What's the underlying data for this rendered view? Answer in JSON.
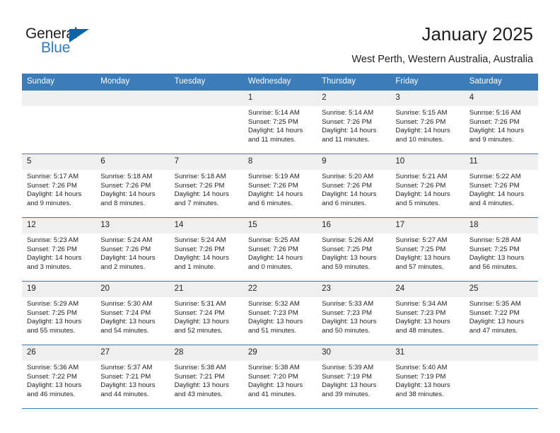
{
  "brand": {
    "name_part1": "General",
    "name_part2": "Blue",
    "triangle_color": "#1263a4",
    "blue_color": "#2b7cc4"
  },
  "header": {
    "title": "January 2025",
    "subtitle": "West Perth, Western Australia, Australia",
    "header_bg": "#3b7cb9"
  },
  "calendar": {
    "weekday_headers": [
      "Sunday",
      "Monday",
      "Tuesday",
      "Wednesday",
      "Thursday",
      "Friday",
      "Saturday"
    ],
    "weeks": [
      [
        {
          "day": "",
          "empty": true
        },
        {
          "day": "",
          "empty": true
        },
        {
          "day": "",
          "empty": true
        },
        {
          "day": "1",
          "sunrise": "Sunrise: 5:14 AM",
          "sunset": "Sunset: 7:25 PM",
          "daylight": "Daylight: 14 hours and 11 minutes."
        },
        {
          "day": "2",
          "sunrise": "Sunrise: 5:14 AM",
          "sunset": "Sunset: 7:26 PM",
          "daylight": "Daylight: 14 hours and 11 minutes."
        },
        {
          "day": "3",
          "sunrise": "Sunrise: 5:15 AM",
          "sunset": "Sunset: 7:26 PM",
          "daylight": "Daylight: 14 hours and 10 minutes."
        },
        {
          "day": "4",
          "sunrise": "Sunrise: 5:16 AM",
          "sunset": "Sunset: 7:26 PM",
          "daylight": "Daylight: 14 hours and 9 minutes."
        }
      ],
      [
        {
          "day": "5",
          "sunrise": "Sunrise: 5:17 AM",
          "sunset": "Sunset: 7:26 PM",
          "daylight": "Daylight: 14 hours and 9 minutes."
        },
        {
          "day": "6",
          "sunrise": "Sunrise: 5:18 AM",
          "sunset": "Sunset: 7:26 PM",
          "daylight": "Daylight: 14 hours and 8 minutes."
        },
        {
          "day": "7",
          "sunrise": "Sunrise: 5:18 AM",
          "sunset": "Sunset: 7:26 PM",
          "daylight": "Daylight: 14 hours and 7 minutes."
        },
        {
          "day": "8",
          "sunrise": "Sunrise: 5:19 AM",
          "sunset": "Sunset: 7:26 PM",
          "daylight": "Daylight: 14 hours and 6 minutes."
        },
        {
          "day": "9",
          "sunrise": "Sunrise: 5:20 AM",
          "sunset": "Sunset: 7:26 PM",
          "daylight": "Daylight: 14 hours and 6 minutes."
        },
        {
          "day": "10",
          "sunrise": "Sunrise: 5:21 AM",
          "sunset": "Sunset: 7:26 PM",
          "daylight": "Daylight: 14 hours and 5 minutes."
        },
        {
          "day": "11",
          "sunrise": "Sunrise: 5:22 AM",
          "sunset": "Sunset: 7:26 PM",
          "daylight": "Daylight: 14 hours and 4 minutes."
        }
      ],
      [
        {
          "day": "12",
          "sunrise": "Sunrise: 5:23 AM",
          "sunset": "Sunset: 7:26 PM",
          "daylight": "Daylight: 14 hours and 3 minutes."
        },
        {
          "day": "13",
          "sunrise": "Sunrise: 5:24 AM",
          "sunset": "Sunset: 7:26 PM",
          "daylight": "Daylight: 14 hours and 2 minutes."
        },
        {
          "day": "14",
          "sunrise": "Sunrise: 5:24 AM",
          "sunset": "Sunset: 7:26 PM",
          "daylight": "Daylight: 14 hours and 1 minute."
        },
        {
          "day": "15",
          "sunrise": "Sunrise: 5:25 AM",
          "sunset": "Sunset: 7:26 PM",
          "daylight": "Daylight: 14 hours and 0 minutes."
        },
        {
          "day": "16",
          "sunrise": "Sunrise: 5:26 AM",
          "sunset": "Sunset: 7:25 PM",
          "daylight": "Daylight: 13 hours and 59 minutes."
        },
        {
          "day": "17",
          "sunrise": "Sunrise: 5:27 AM",
          "sunset": "Sunset: 7:25 PM",
          "daylight": "Daylight: 13 hours and 57 minutes."
        },
        {
          "day": "18",
          "sunrise": "Sunrise: 5:28 AM",
          "sunset": "Sunset: 7:25 PM",
          "daylight": "Daylight: 13 hours and 56 minutes."
        }
      ],
      [
        {
          "day": "19",
          "sunrise": "Sunrise: 5:29 AM",
          "sunset": "Sunset: 7:25 PM",
          "daylight": "Daylight: 13 hours and 55 minutes."
        },
        {
          "day": "20",
          "sunrise": "Sunrise: 5:30 AM",
          "sunset": "Sunset: 7:24 PM",
          "daylight": "Daylight: 13 hours and 54 minutes."
        },
        {
          "day": "21",
          "sunrise": "Sunrise: 5:31 AM",
          "sunset": "Sunset: 7:24 PM",
          "daylight": "Daylight: 13 hours and 52 minutes."
        },
        {
          "day": "22",
          "sunrise": "Sunrise: 5:32 AM",
          "sunset": "Sunset: 7:23 PM",
          "daylight": "Daylight: 13 hours and 51 minutes."
        },
        {
          "day": "23",
          "sunrise": "Sunrise: 5:33 AM",
          "sunset": "Sunset: 7:23 PM",
          "daylight": "Daylight: 13 hours and 50 minutes."
        },
        {
          "day": "24",
          "sunrise": "Sunrise: 5:34 AM",
          "sunset": "Sunset: 7:23 PM",
          "daylight": "Daylight: 13 hours and 48 minutes."
        },
        {
          "day": "25",
          "sunrise": "Sunrise: 5:35 AM",
          "sunset": "Sunset: 7:22 PM",
          "daylight": "Daylight: 13 hours and 47 minutes."
        }
      ],
      [
        {
          "day": "26",
          "sunrise": "Sunrise: 5:36 AM",
          "sunset": "Sunset: 7:22 PM",
          "daylight": "Daylight: 13 hours and 46 minutes."
        },
        {
          "day": "27",
          "sunrise": "Sunrise: 5:37 AM",
          "sunset": "Sunset: 7:21 PM",
          "daylight": "Daylight: 13 hours and 44 minutes."
        },
        {
          "day": "28",
          "sunrise": "Sunrise: 5:38 AM",
          "sunset": "Sunset: 7:21 PM",
          "daylight": "Daylight: 13 hours and 43 minutes."
        },
        {
          "day": "29",
          "sunrise": "Sunrise: 5:38 AM",
          "sunset": "Sunset: 7:20 PM",
          "daylight": "Daylight: 13 hours and 41 minutes."
        },
        {
          "day": "30",
          "sunrise": "Sunrise: 5:39 AM",
          "sunset": "Sunset: 7:19 PM",
          "daylight": "Daylight: 13 hours and 39 minutes."
        },
        {
          "day": "31",
          "sunrise": "Sunrise: 5:40 AM",
          "sunset": "Sunset: 7:19 PM",
          "daylight": "Daylight: 13 hours and 38 minutes."
        },
        {
          "day": "",
          "empty": true
        }
      ]
    ]
  }
}
